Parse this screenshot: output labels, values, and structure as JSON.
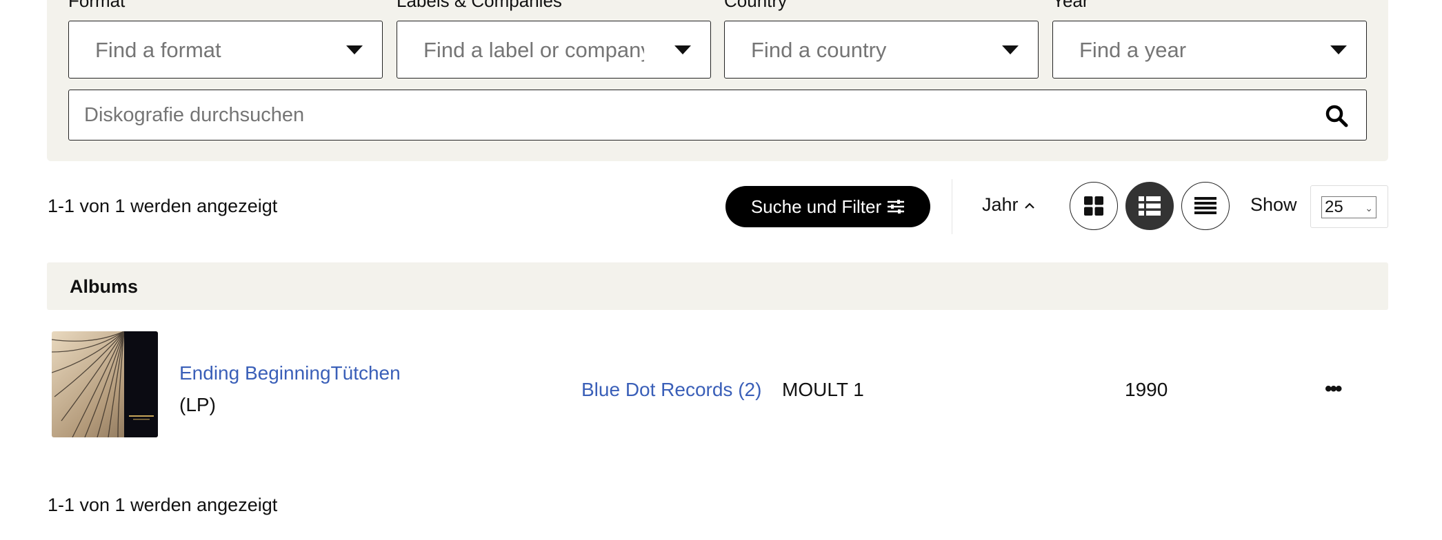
{
  "filters": {
    "format": {
      "label": "Format",
      "placeholder": "Find a format"
    },
    "labels": {
      "label": "Labels & Companies",
      "placeholder": "Find a label or company"
    },
    "country": {
      "label": "Country",
      "placeholder": "Find a country"
    },
    "year": {
      "label": "Year",
      "placeholder": "Find a year"
    }
  },
  "search": {
    "placeholder": "Diskografie durchsuchen",
    "icon": "search-icon"
  },
  "results_count_top": "1-1 von 1 werden angezeigt",
  "results_count_bottom": "1-1 von 1 werden angezeigt",
  "toolbar": {
    "filter_button": "Suche und Filter",
    "sort_label": "Jahr",
    "view_modes": [
      "grid-view-icon",
      "list-view-icon",
      "compact-list-view-icon"
    ],
    "active_view": "list-view-icon",
    "show_label": "Show",
    "show_value": "25"
  },
  "section": {
    "title": "Albums"
  },
  "releases": [
    {
      "title": "Ending BeginningTütchen",
      "format": "(LP)",
      "label": "Blue Dot Records (2)",
      "catno": "MOULT 1",
      "year": "1990",
      "more_icon": "more-options-icon"
    }
  ],
  "colors": {
    "panel_bg": "#f3f2ec",
    "link": "#3a5fb8",
    "button_bg": "#000000",
    "active_view_bg": "#333333"
  }
}
